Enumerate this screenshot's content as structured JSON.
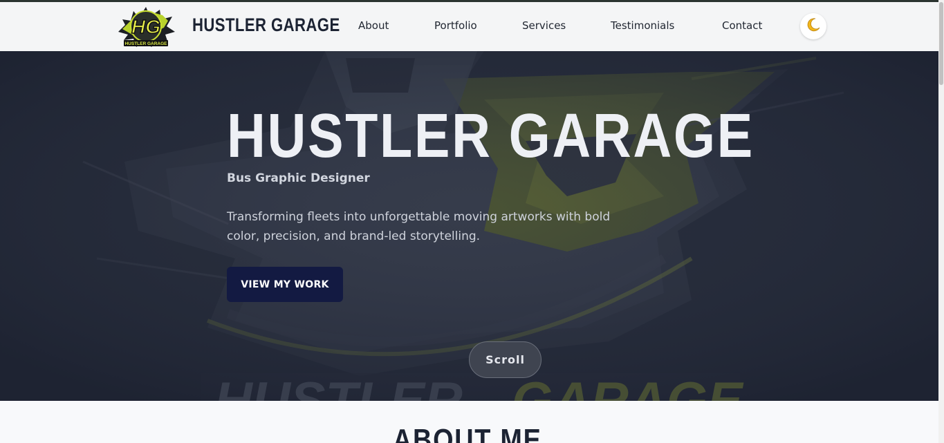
{
  "nav": {
    "brand": "HUSTLER GARAGE",
    "logo_text": "HG",
    "logo_subtext": "HUSTLER GARAGE",
    "links": [
      "About",
      "Portfolio",
      "Services",
      "Testimonials",
      "Contact"
    ],
    "theme_icon": "moon-icon"
  },
  "hero": {
    "title": "HUSTLER GARAGE",
    "subtitle": "Bus Graphic Designer",
    "description": "Transforming fleets into unforgettable moving artworks with bold color, precision, and brand-led storytelling.",
    "cta_label": "VIEW MY WORK",
    "scroll_label": "Scroll",
    "watermark_left": "HUSTLER",
    "watermark_right": "GARAGE"
  },
  "about": {
    "title": "ABOUT ME"
  },
  "colors": {
    "hero_bg": "#262c3a",
    "accent_olive": "#6d7a2c",
    "cta_bg": "#131a42",
    "nav_bg": "#f4f5f6"
  }
}
